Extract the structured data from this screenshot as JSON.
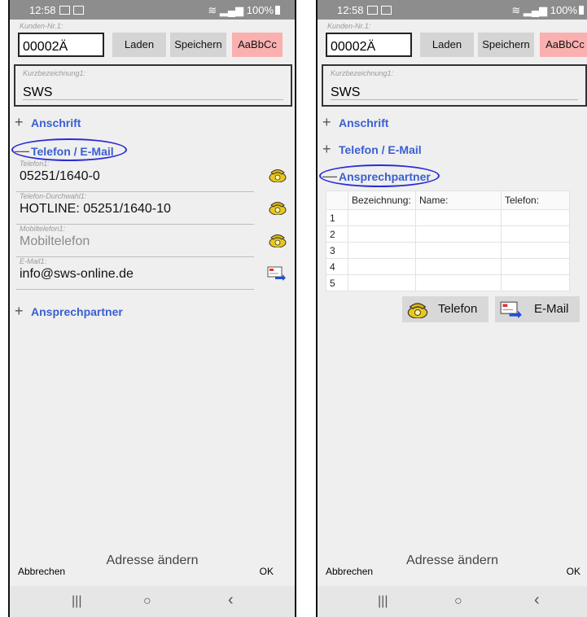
{
  "status": {
    "time": "12:58",
    "battery": "100%"
  },
  "header": {
    "kunden_label": "Kunden-Nr.1:",
    "kunden_value": "00002Ä",
    "load_button": "Laden",
    "save_button": "Speichern",
    "font_button": "AaBbCc",
    "kurz_label": "Kurzbezeichnung1:",
    "kurz_value": "SWS"
  },
  "left": {
    "sections": {
      "anschrift": "Anschrift",
      "telefon": "Telefon / E-Mail",
      "ansprech": "Ansprechpartner"
    },
    "signs": {
      "plus": "+",
      "minus": "—"
    },
    "fields": [
      {
        "label": "Telefon1:",
        "value": "05251/1640-0",
        "icon": "phone-icon"
      },
      {
        "label": "Telefon-Durchwahl1:",
        "value": "HOTLINE: 05251/1640-10",
        "icon": "phone-icon"
      },
      {
        "label": "Mobiltelefon1:",
        "value": "Mobiltelefon",
        "icon": "phone-icon"
      },
      {
        "label": "E-Mail1:",
        "value": "info@sws-online.de",
        "icon": "mail-send-icon"
      }
    ]
  },
  "right": {
    "sections": {
      "anschrift": "Anschrift",
      "telefon": "Telefon / E-Mail",
      "ansprech": "Ansprechpartner"
    },
    "table": {
      "headers": [
        "",
        "Bezeichnung:",
        "Name:",
        "Telefon:"
      ],
      "row_numbers": [
        "1",
        "2",
        "3",
        "4",
        "5"
      ]
    },
    "phone_button": "Telefon",
    "email_button": "E-Mail"
  },
  "footer": {
    "cancel": "Abbrechen",
    "title": "Adresse ändern",
    "ok": "OK"
  },
  "navbar": {
    "recent": "|||",
    "home": "○",
    "back": "‹"
  },
  "colors": {
    "accent": "#3a5fd0",
    "highlight_oval": "#2b2bd6",
    "font_button_bg": "#fbb0b0"
  }
}
